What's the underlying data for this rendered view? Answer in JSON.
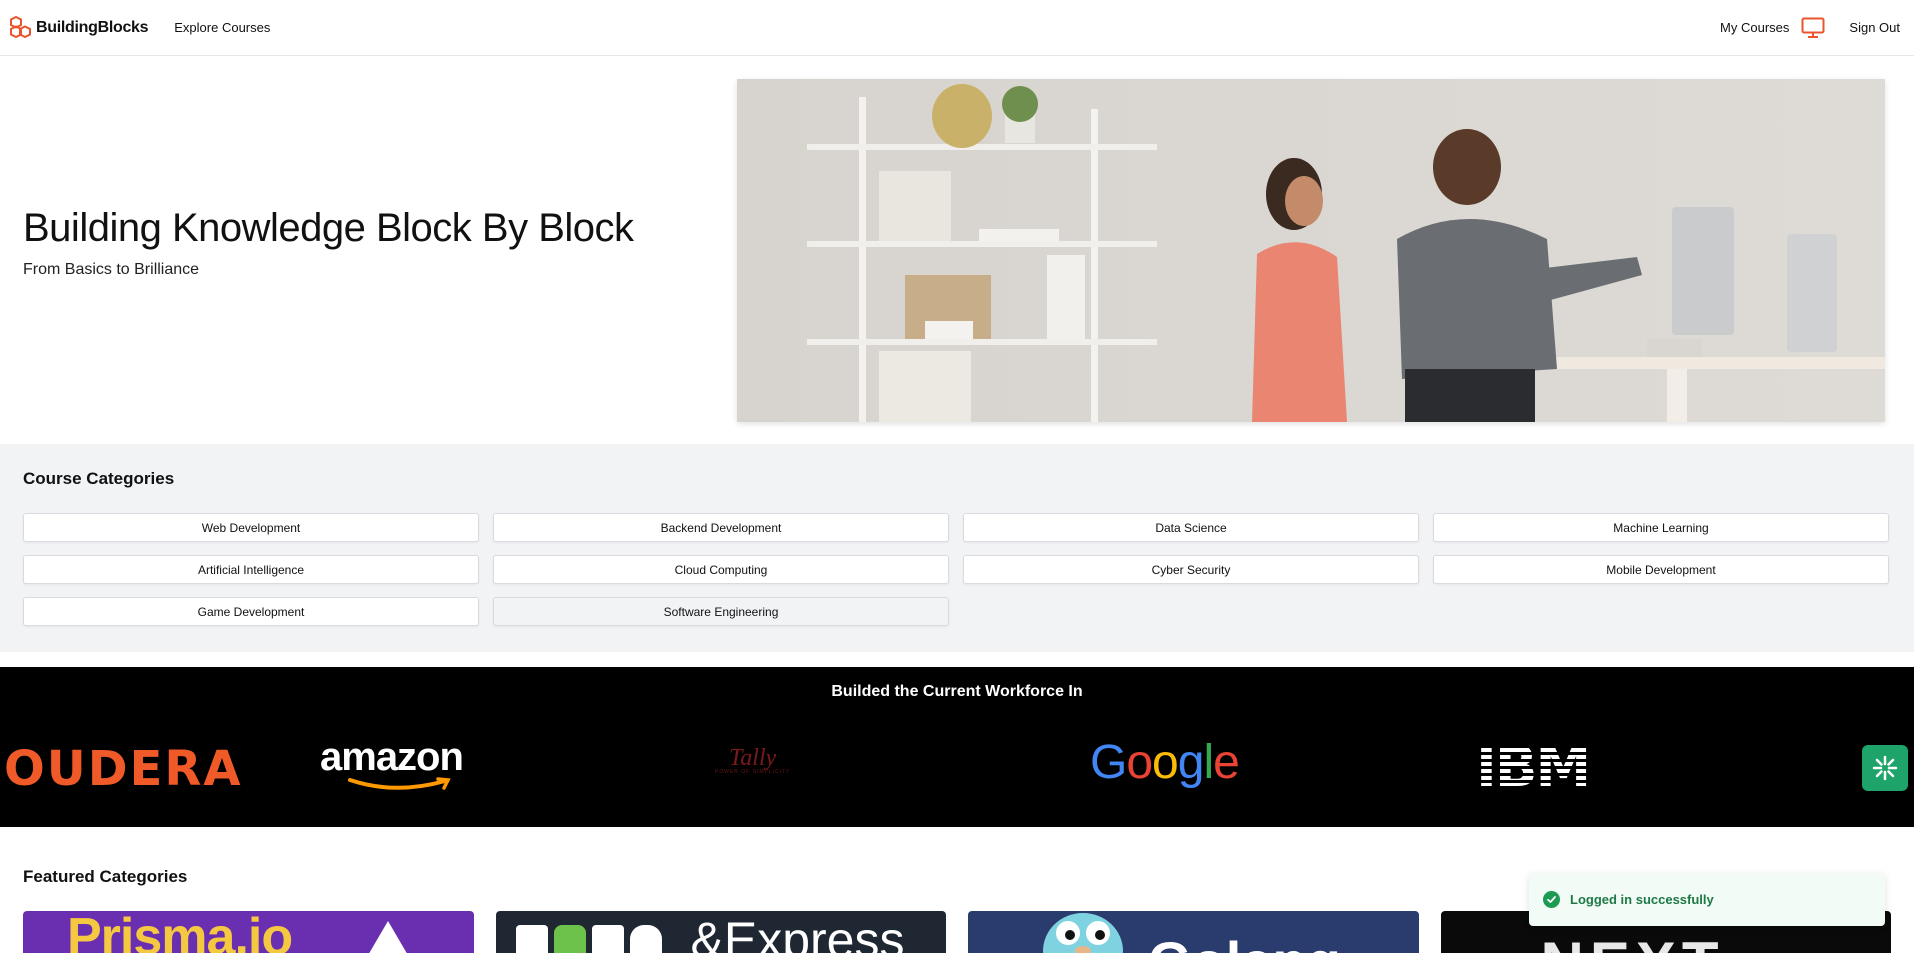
{
  "navbar": {
    "brand": "BuildingBlocks",
    "explore": "Explore Courses",
    "my_courses": "My Courses",
    "sign_out": "Sign Out",
    "accent": "#e8542b"
  },
  "hero": {
    "title": "Building Knowledge Block By Block",
    "subtitle": "From Basics to Brilliance"
  },
  "categories": {
    "title": "Course Categories",
    "items": [
      "Web Development",
      "Backend Development",
      "Data Science",
      "Machine Learning",
      "Artificial Intelligence",
      "Cloud Computing",
      "Cyber Security",
      "Mobile Development",
      "Game Development",
      "Software Engineering"
    ]
  },
  "workforce": {
    "title": "Builded the Current Workforce In",
    "logos": {
      "cloudera": "OUDERA",
      "amazon": "amazon",
      "tally": "Tally",
      "tally_tagline": "POWER OF SIMPLICITY",
      "google": "Google",
      "ibm": "IBM"
    }
  },
  "featured": {
    "title": "Featured Categories",
    "cards": [
      {
        "label": "Prisma.io",
        "color": "#6a2fb0"
      },
      {
        "label": "&Express",
        "color": "#1f2733"
      },
      {
        "label": "Golang",
        "color": "#2a3b6d"
      },
      {
        "label": "NEXT",
        "color": "#0a0a0a"
      }
    ]
  },
  "toast": {
    "message": "Logged in successfully",
    "color": "#1d9a53"
  }
}
